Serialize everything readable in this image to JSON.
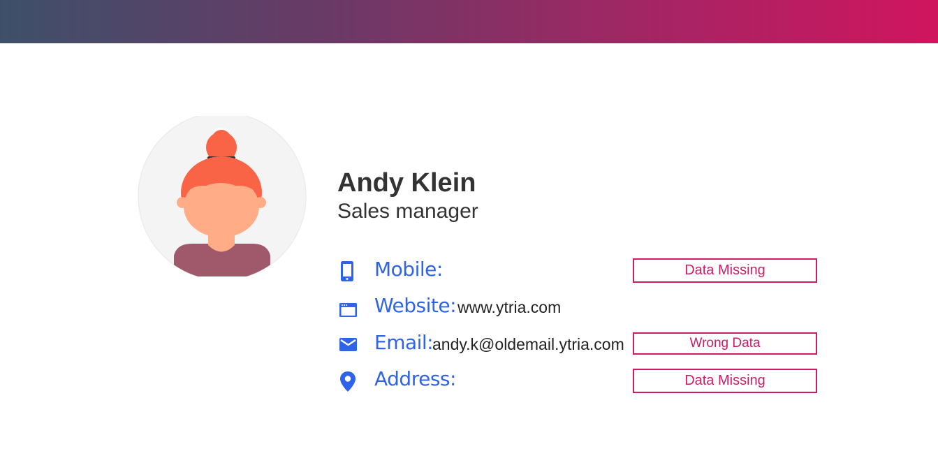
{
  "header": {
    "gradient_start": "#3d506a",
    "gradient_end": "#d0155f"
  },
  "profile": {
    "name": "Andy Klein",
    "role": "Sales manager",
    "avatar_icon": "woman-avatar-icon"
  },
  "contact": {
    "mobile": {
      "icon": "mobile-phone-icon",
      "label": "Mobile:",
      "value": "",
      "flag": "Data Missing"
    },
    "website": {
      "icon": "browser-window-icon",
      "label": "Website:",
      "value": "www.ytria.com",
      "flag": ""
    },
    "email": {
      "icon": "envelope-icon",
      "label": "Email:",
      "value": "andy.k@oldemail.ytria.com",
      "flag": "Wrong Data"
    },
    "address": {
      "icon": "location-pin-icon",
      "label": "Address:",
      "value": "",
      "flag": "Data Missing"
    }
  },
  "colors": {
    "label_blue": "#2f63e8",
    "flag_pink": "#cc1c64",
    "text_dark": "#333333"
  }
}
